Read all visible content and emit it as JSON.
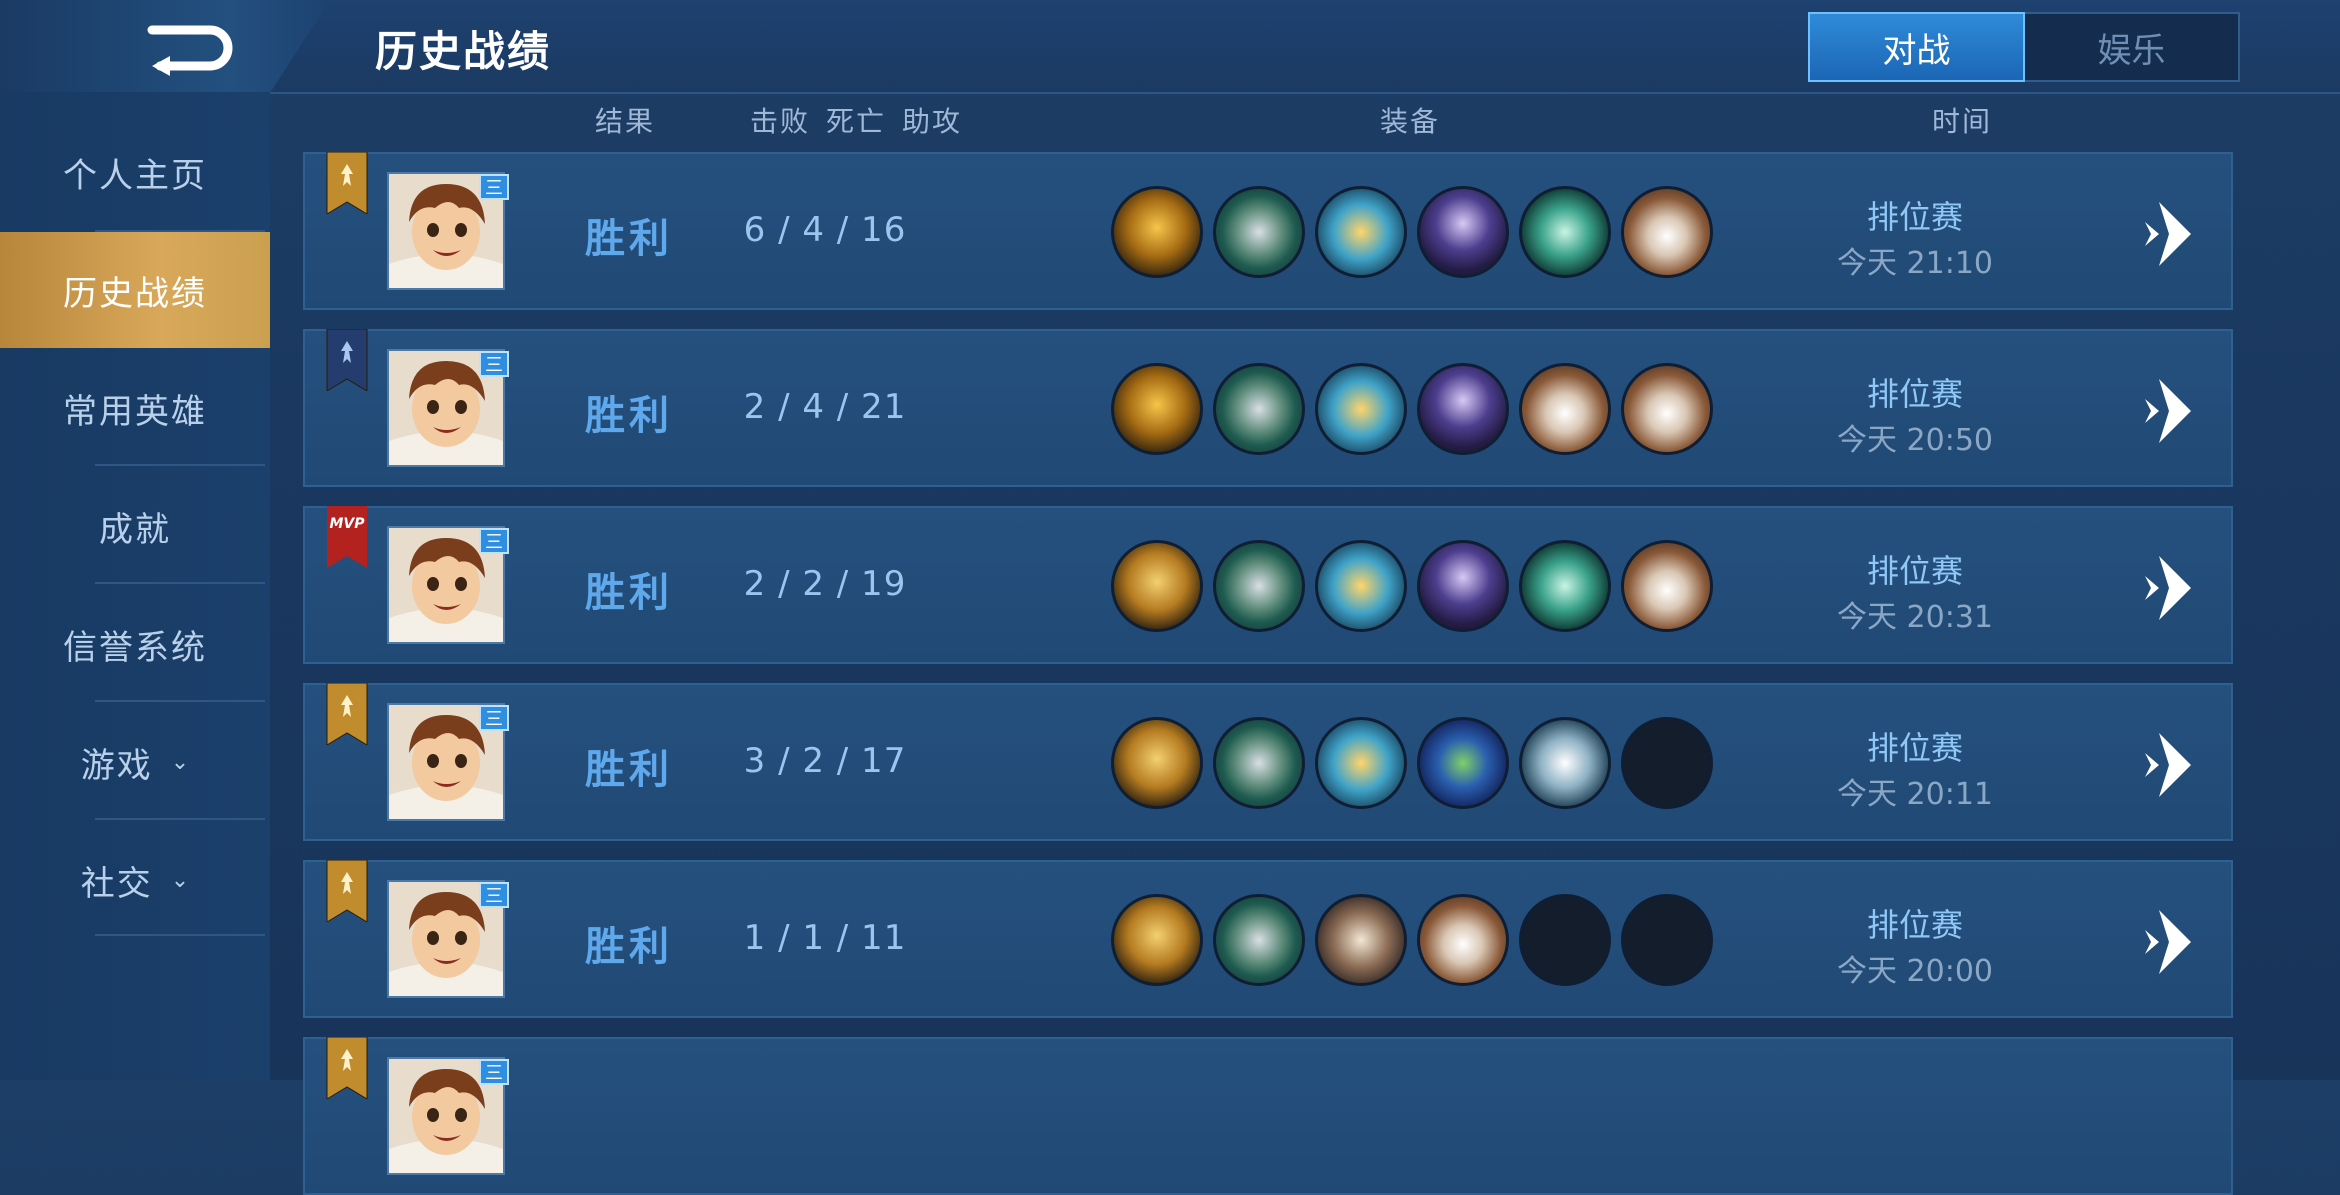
{
  "header": {
    "title": "历史战绩",
    "tabs": [
      {
        "label": "对战",
        "active": true
      },
      {
        "label": "娱乐",
        "active": false
      }
    ]
  },
  "sidebar": {
    "items": [
      {
        "label": "个人主页",
        "active": false,
        "has_chevron": false
      },
      {
        "label": "历史战绩",
        "active": true,
        "has_chevron": false
      },
      {
        "label": "常用英雄",
        "active": false,
        "has_chevron": false
      },
      {
        "label": "成就",
        "active": false,
        "has_chevron": false
      },
      {
        "label": "信誉系统",
        "active": false,
        "has_chevron": false
      },
      {
        "label": "游戏",
        "active": false,
        "has_chevron": true
      },
      {
        "label": "社交",
        "active": false,
        "has_chevron": true
      }
    ]
  },
  "columns": {
    "result": "结果",
    "kills": "击败",
    "deaths": "死亡",
    "assists": "助攻",
    "equipment": "装备",
    "time": "时间"
  },
  "rows": [
    {
      "badge": "gold",
      "hero_tag": "三",
      "result": "胜利",
      "kda": "6 / 4 / 16",
      "equipment": [
        "eq-gold",
        "eq-boot",
        "eq-wing",
        "eq-cape",
        "eq-sword",
        "eq-armor"
      ],
      "mode": "排位赛",
      "time": "今天 21:10"
    },
    {
      "badge": "blue",
      "hero_tag": "三",
      "result": "胜利",
      "kda": "2 / 4 / 21",
      "equipment": [
        "eq-gold",
        "eq-boot",
        "eq-wing",
        "eq-cape",
        "eq-armor",
        "eq-armor"
      ],
      "mode": "排位赛",
      "time": "今天 20:50"
    },
    {
      "badge": "mvp",
      "badge_text": "MVP",
      "hero_tag": "三",
      "result": "胜利",
      "kda": "2 / 2 / 19",
      "equipment": [
        "eq-gold2",
        "eq-boot",
        "eq-wing",
        "eq-cape",
        "eq-sword",
        "eq-armor"
      ],
      "mode": "排位赛",
      "time": "今天 20:31"
    },
    {
      "badge": "gold",
      "hero_tag": "三",
      "result": "胜利",
      "kda": "3 / 2 / 17",
      "equipment": [
        "eq-gold2",
        "eq-boot",
        "eq-wing",
        "eq-hood",
        "eq-belt",
        "empty"
      ],
      "mode": "排位赛",
      "time": "今天 20:11"
    },
    {
      "badge": "gold",
      "hero_tag": "三",
      "result": "胜利",
      "kda": "1 / 1 / 11",
      "equipment": [
        "eq-gold2",
        "eq-boot",
        "eq-plate",
        "eq-armor",
        "empty",
        "empty"
      ],
      "mode": "排位赛",
      "time": "今天 20:00"
    },
    {
      "badge": "gold",
      "hero_tag": "三",
      "result": "",
      "kda": "",
      "equipment": [],
      "mode": "",
      "time": ""
    }
  ],
  "colors": {
    "accent": "#5fa8ec",
    "active_tab": "#1b66b5",
    "sidebar_active": "#d9a85a"
  }
}
